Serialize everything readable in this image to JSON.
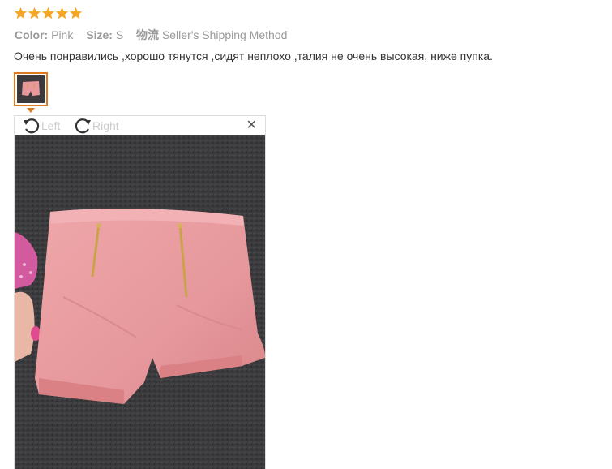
{
  "review": {
    "rating": 5,
    "star_color": "#f5a623",
    "color_label": "Color:",
    "color_value": "Pink",
    "size_label": "Size:",
    "size_value": "S",
    "shipping_label": "物流",
    "shipping_value": "Seller's Shipping Method",
    "comment": "Очень понравились ,хорошо тянутся ,сидят неплохо ,талия не очень высокая, ниже пупка."
  },
  "viewer": {
    "rotate_left_label": "Left",
    "rotate_right_label": "Right",
    "close_icon": "close-icon",
    "accent": "#e07a1e",
    "photo_subject": "pink high-waist shorts with gold zippers on dark carpet"
  }
}
